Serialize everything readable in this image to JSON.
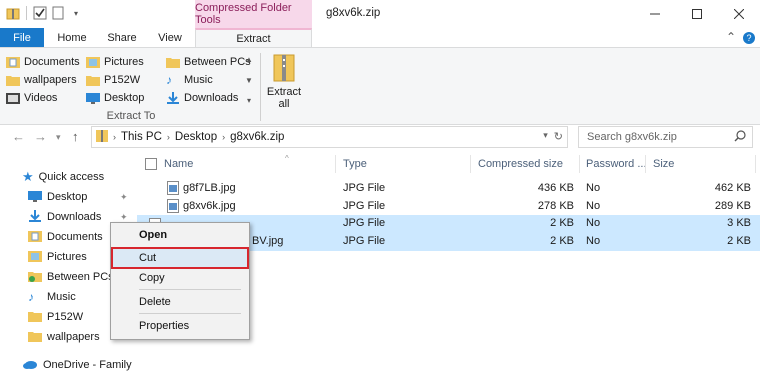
{
  "window": {
    "title": "g8xv6k.zip",
    "context_tab_header": "Compressed Folder Tools",
    "controls": [
      "minimize",
      "maximize",
      "close"
    ]
  },
  "ribbon": {
    "tabs": [
      "File",
      "Home",
      "Share",
      "View",
      "Extract"
    ],
    "active_tab": "Extract",
    "extract_to_items": [
      {
        "label": "Documents",
        "icon": "documents-icon"
      },
      {
        "label": "Pictures",
        "icon": "pictures-icon"
      },
      {
        "label": "Between PCs",
        "icon": "folder-icon"
      },
      {
        "label": "wallpapers",
        "icon": "folder-icon"
      },
      {
        "label": "P152W",
        "icon": "folder-icon"
      },
      {
        "label": "Music",
        "icon": "music-icon"
      },
      {
        "label": "Videos",
        "icon": "videos-icon"
      },
      {
        "label": "Desktop",
        "icon": "desktop-icon"
      },
      {
        "label": "Downloads",
        "icon": "downloads-icon"
      }
    ],
    "group_label": "Extract To",
    "extract_all_line1": "Extract",
    "extract_all_line2": "all"
  },
  "address": {
    "segments": [
      "This PC",
      "Desktop",
      "g8xv6k.zip"
    ],
    "search_placeholder": "Search g8xv6k.zip"
  },
  "nav_pane": {
    "items": [
      {
        "label": "Quick access",
        "icon": "star-icon",
        "pinned": false
      },
      {
        "label": "Desktop",
        "icon": "desktop-icon",
        "pinned": true
      },
      {
        "label": "Downloads",
        "icon": "downloads-icon",
        "pinned": true
      },
      {
        "label": "Documents",
        "icon": "documents-icon",
        "pinned": false
      },
      {
        "label": "Pictures",
        "icon": "pictures-icon",
        "pinned": false
      },
      {
        "label": "Between PCs",
        "icon": "folder-icon",
        "pinned": false
      },
      {
        "label": "Music",
        "icon": "music-icon",
        "pinned": false
      },
      {
        "label": "P152W",
        "icon": "folder-icon",
        "pinned": false
      },
      {
        "label": "wallpapers",
        "icon": "folder-icon",
        "pinned": false
      },
      {
        "label": "OneDrive - Family",
        "icon": "onedrive-icon",
        "pinned": false
      }
    ]
  },
  "file_list": {
    "columns": [
      "Name",
      "Type",
      "Compressed size",
      "Password ...",
      "Size"
    ],
    "rows": [
      {
        "name": "g8f7LB.jpg",
        "type": "JPG File",
        "compressed": "436 KB",
        "password": "No",
        "size": "462 KB",
        "selected": false
      },
      {
        "name": "g8xv6k.jpg",
        "type": "JPG File",
        "compressed": "278 KB",
        "password": "No",
        "size": "289 KB",
        "selected": false
      },
      {
        "name": "",
        "type": "JPG File",
        "compressed": "2 KB",
        "password": "No",
        "size": "3 KB",
        "selected": true
      },
      {
        "name": "BV.jpg",
        "type": "JPG File",
        "compressed": "2 KB",
        "password": "No",
        "size": "2 KB",
        "selected": true
      }
    ]
  },
  "context_menu": {
    "items": [
      "Open",
      "Cut",
      "Copy",
      "Delete",
      "Properties"
    ],
    "highlighted": "Cut"
  },
  "colors": {
    "file_tab": "#1979ca",
    "context_tab": "#f7d8ea",
    "selection": "#cce8ff",
    "highlight_box": "#d7262e",
    "folder": "#f0c65a"
  }
}
